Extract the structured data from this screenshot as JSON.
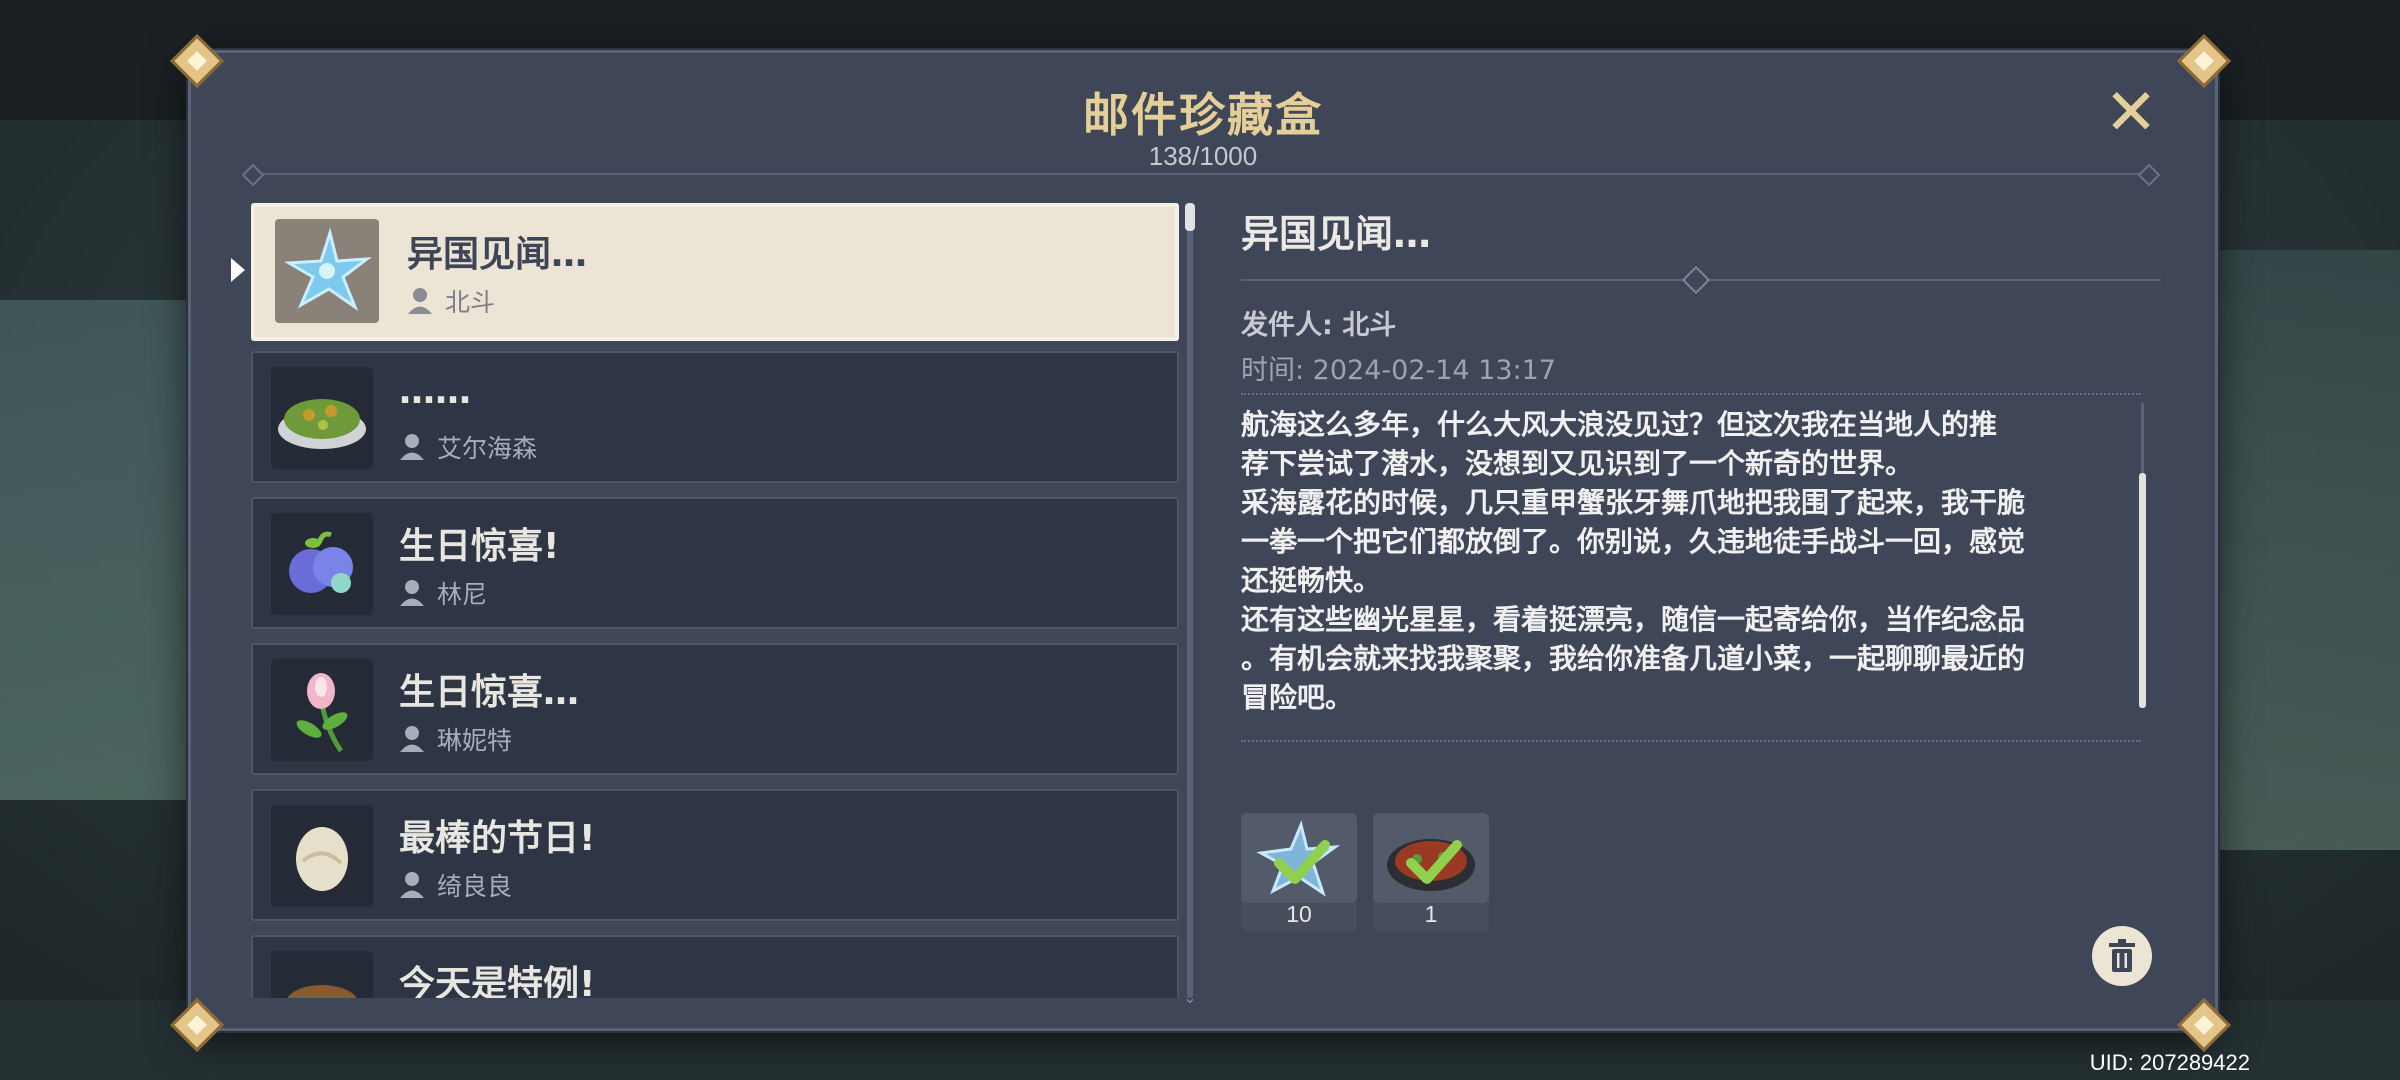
{
  "window": {
    "title": "邮件珍藏盒",
    "count": "138/1000",
    "close_icon": "close-icon"
  },
  "mail_list": {
    "items": [
      {
        "subject": "异国见闻…",
        "sender": "北斗",
        "icon": "starfish-icon",
        "selected": true
      },
      {
        "subject": "……",
        "sender": "艾尔海森",
        "icon": "dish-icon",
        "selected": false
      },
      {
        "subject": "生日惊喜!",
        "sender": "林尼",
        "icon": "fruit-icon",
        "selected": false
      },
      {
        "subject": "生日惊喜…",
        "sender": "琳妮特",
        "icon": "flower-icon",
        "selected": false
      },
      {
        "subject": "最棒的节日!",
        "sender": "绮良良",
        "icon": "egg-icon",
        "selected": false
      },
      {
        "subject": "今天是特例!",
        "sender": "",
        "icon": "dish-icon",
        "selected": false
      }
    ]
  },
  "detail": {
    "subject": "异国见闻…",
    "from": "发件人: 北斗",
    "time": "时间: 2024-02-14 13:17",
    "body": "航海这么多年，什么大风大浪没见过？但这次我在当地人的推\n荐下尝试了潜水，没想到又见识到了一个新奇的世界。\n采海露花的时候，几只重甲蟹张牙舞爪地把我围了起来，我干脆\n一拳一个把它们都放倒了。你别说，久违地徒手战斗一回，感觉\n还挺畅快。\n还有这些幽光星星，看着挺漂亮，随信一起寄给你，当作纪念品\n。有机会就来找我聚聚，我给你准备几道小菜，一起聊聊最近的\n冒险吧。",
    "attachments": [
      {
        "icon": "starfish-icon",
        "qty": "10",
        "claimed": true
      },
      {
        "icon": "dish-icon",
        "qty": "1",
        "claimed": true
      }
    ],
    "delete_icon": "trash-icon"
  },
  "footer": {
    "uid": "UID: 207289422"
  },
  "colors": {
    "accent_gold": "#e5cf98",
    "panel": "#3f4658",
    "selected_row": "#ece5d6",
    "check_green": "#8fd14f"
  }
}
